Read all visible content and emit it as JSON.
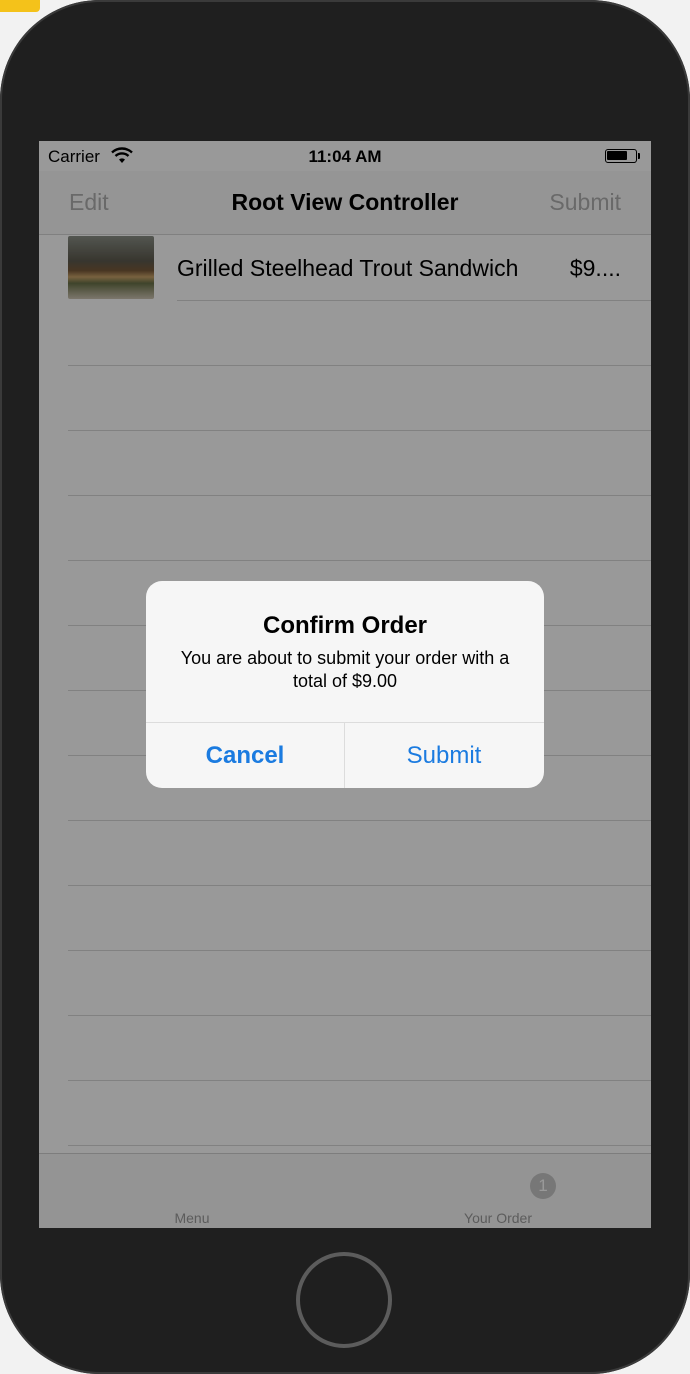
{
  "status_bar": {
    "carrier": "Carrier",
    "time": "11:04 AM"
  },
  "nav": {
    "left_label": "Edit",
    "title": "Root View Controller",
    "right_label": "Submit"
  },
  "order_items": [
    {
      "name": "Grilled Steelhead Trout Sandwich",
      "price": "$9...."
    }
  ],
  "tab_bar": {
    "tabs": [
      {
        "label": "Menu"
      },
      {
        "label": "Your Order",
        "badge": "1"
      }
    ]
  },
  "alert": {
    "title": "Confirm Order",
    "message": "You are about to submit your order with a total of $9.00",
    "cancel_label": "Cancel",
    "submit_label": "Submit"
  },
  "colors": {
    "accent": "#1b7be0",
    "dim_overlay": "rgba(0,0,0,0.40)"
  },
  "icons": [
    "wifi-icon",
    "battery-icon",
    "home-button"
  ]
}
